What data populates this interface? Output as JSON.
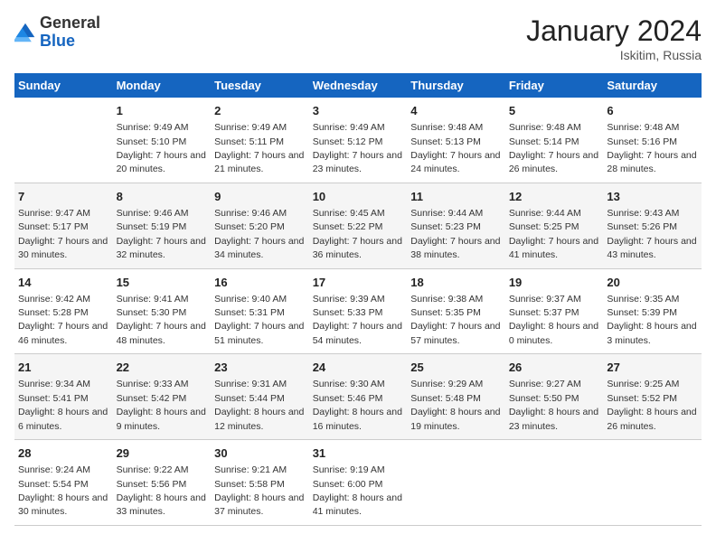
{
  "logo": {
    "general": "General",
    "blue": "Blue"
  },
  "title": "January 2024",
  "location": "Iskitim, Russia",
  "days_of_week": [
    "Sunday",
    "Monday",
    "Tuesday",
    "Wednesday",
    "Thursday",
    "Friday",
    "Saturday"
  ],
  "weeks": [
    [
      {
        "day": "",
        "sunrise": "",
        "sunset": "",
        "daylight": ""
      },
      {
        "day": "1",
        "sunrise": "Sunrise: 9:49 AM",
        "sunset": "Sunset: 5:10 PM",
        "daylight": "Daylight: 7 hours and 20 minutes."
      },
      {
        "day": "2",
        "sunrise": "Sunrise: 9:49 AM",
        "sunset": "Sunset: 5:11 PM",
        "daylight": "Daylight: 7 hours and 21 minutes."
      },
      {
        "day": "3",
        "sunrise": "Sunrise: 9:49 AM",
        "sunset": "Sunset: 5:12 PM",
        "daylight": "Daylight: 7 hours and 23 minutes."
      },
      {
        "day": "4",
        "sunrise": "Sunrise: 9:48 AM",
        "sunset": "Sunset: 5:13 PM",
        "daylight": "Daylight: 7 hours and 24 minutes."
      },
      {
        "day": "5",
        "sunrise": "Sunrise: 9:48 AM",
        "sunset": "Sunset: 5:14 PM",
        "daylight": "Daylight: 7 hours and 26 minutes."
      },
      {
        "day": "6",
        "sunrise": "Sunrise: 9:48 AM",
        "sunset": "Sunset: 5:16 PM",
        "daylight": "Daylight: 7 hours and 28 minutes."
      }
    ],
    [
      {
        "day": "7",
        "sunrise": "Sunrise: 9:47 AM",
        "sunset": "Sunset: 5:17 PM",
        "daylight": "Daylight: 7 hours and 30 minutes."
      },
      {
        "day": "8",
        "sunrise": "Sunrise: 9:46 AM",
        "sunset": "Sunset: 5:19 PM",
        "daylight": "Daylight: 7 hours and 32 minutes."
      },
      {
        "day": "9",
        "sunrise": "Sunrise: 9:46 AM",
        "sunset": "Sunset: 5:20 PM",
        "daylight": "Daylight: 7 hours and 34 minutes."
      },
      {
        "day": "10",
        "sunrise": "Sunrise: 9:45 AM",
        "sunset": "Sunset: 5:22 PM",
        "daylight": "Daylight: 7 hours and 36 minutes."
      },
      {
        "day": "11",
        "sunrise": "Sunrise: 9:44 AM",
        "sunset": "Sunset: 5:23 PM",
        "daylight": "Daylight: 7 hours and 38 minutes."
      },
      {
        "day": "12",
        "sunrise": "Sunrise: 9:44 AM",
        "sunset": "Sunset: 5:25 PM",
        "daylight": "Daylight: 7 hours and 41 minutes."
      },
      {
        "day": "13",
        "sunrise": "Sunrise: 9:43 AM",
        "sunset": "Sunset: 5:26 PM",
        "daylight": "Daylight: 7 hours and 43 minutes."
      }
    ],
    [
      {
        "day": "14",
        "sunrise": "Sunrise: 9:42 AM",
        "sunset": "Sunset: 5:28 PM",
        "daylight": "Daylight: 7 hours and 46 minutes."
      },
      {
        "day": "15",
        "sunrise": "Sunrise: 9:41 AM",
        "sunset": "Sunset: 5:30 PM",
        "daylight": "Daylight: 7 hours and 48 minutes."
      },
      {
        "day": "16",
        "sunrise": "Sunrise: 9:40 AM",
        "sunset": "Sunset: 5:31 PM",
        "daylight": "Daylight: 7 hours and 51 minutes."
      },
      {
        "day": "17",
        "sunrise": "Sunrise: 9:39 AM",
        "sunset": "Sunset: 5:33 PM",
        "daylight": "Daylight: 7 hours and 54 minutes."
      },
      {
        "day": "18",
        "sunrise": "Sunrise: 9:38 AM",
        "sunset": "Sunset: 5:35 PM",
        "daylight": "Daylight: 7 hours and 57 minutes."
      },
      {
        "day": "19",
        "sunrise": "Sunrise: 9:37 AM",
        "sunset": "Sunset: 5:37 PM",
        "daylight": "Daylight: 8 hours and 0 minutes."
      },
      {
        "day": "20",
        "sunrise": "Sunrise: 9:35 AM",
        "sunset": "Sunset: 5:39 PM",
        "daylight": "Daylight: 8 hours and 3 minutes."
      }
    ],
    [
      {
        "day": "21",
        "sunrise": "Sunrise: 9:34 AM",
        "sunset": "Sunset: 5:41 PM",
        "daylight": "Daylight: 8 hours and 6 minutes."
      },
      {
        "day": "22",
        "sunrise": "Sunrise: 9:33 AM",
        "sunset": "Sunset: 5:42 PM",
        "daylight": "Daylight: 8 hours and 9 minutes."
      },
      {
        "day": "23",
        "sunrise": "Sunrise: 9:31 AM",
        "sunset": "Sunset: 5:44 PM",
        "daylight": "Daylight: 8 hours and 12 minutes."
      },
      {
        "day": "24",
        "sunrise": "Sunrise: 9:30 AM",
        "sunset": "Sunset: 5:46 PM",
        "daylight": "Daylight: 8 hours and 16 minutes."
      },
      {
        "day": "25",
        "sunrise": "Sunrise: 9:29 AM",
        "sunset": "Sunset: 5:48 PM",
        "daylight": "Daylight: 8 hours and 19 minutes."
      },
      {
        "day": "26",
        "sunrise": "Sunrise: 9:27 AM",
        "sunset": "Sunset: 5:50 PM",
        "daylight": "Daylight: 8 hours and 23 minutes."
      },
      {
        "day": "27",
        "sunrise": "Sunrise: 9:25 AM",
        "sunset": "Sunset: 5:52 PM",
        "daylight": "Daylight: 8 hours and 26 minutes."
      }
    ],
    [
      {
        "day": "28",
        "sunrise": "Sunrise: 9:24 AM",
        "sunset": "Sunset: 5:54 PM",
        "daylight": "Daylight: 8 hours and 30 minutes."
      },
      {
        "day": "29",
        "sunrise": "Sunrise: 9:22 AM",
        "sunset": "Sunset: 5:56 PM",
        "daylight": "Daylight: 8 hours and 33 minutes."
      },
      {
        "day": "30",
        "sunrise": "Sunrise: 9:21 AM",
        "sunset": "Sunset: 5:58 PM",
        "daylight": "Daylight: 8 hours and 37 minutes."
      },
      {
        "day": "31",
        "sunrise": "Sunrise: 9:19 AM",
        "sunset": "Sunset: 6:00 PM",
        "daylight": "Daylight: 8 hours and 41 minutes."
      },
      {
        "day": "",
        "sunrise": "",
        "sunset": "",
        "daylight": ""
      },
      {
        "day": "",
        "sunrise": "",
        "sunset": "",
        "daylight": ""
      },
      {
        "day": "",
        "sunrise": "",
        "sunset": "",
        "daylight": ""
      }
    ]
  ]
}
